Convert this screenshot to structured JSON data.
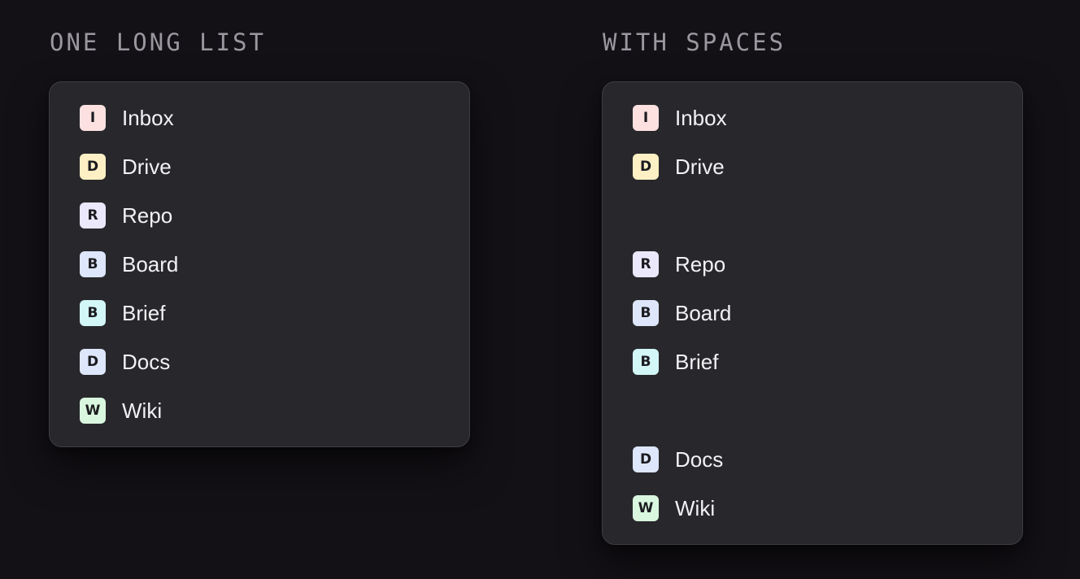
{
  "left": {
    "heading": "ONE LONG LIST",
    "items": [
      {
        "letter": "I",
        "label": "Inbox",
        "color": "#fde1e1"
      },
      {
        "letter": "D",
        "label": "Drive",
        "color": "#fdf0c4"
      },
      {
        "letter": "R",
        "label": "Repo",
        "color": "#ebe8fb"
      },
      {
        "letter": "B",
        "label": "Board",
        "color": "#dde6fb"
      },
      {
        "letter": "B",
        "label": "Brief",
        "color": "#d3f6f7"
      },
      {
        "letter": "D",
        "label": "Docs",
        "color": "#dde6fb"
      },
      {
        "letter": "W",
        "label": "Wiki",
        "color": "#d9f7df"
      }
    ]
  },
  "right": {
    "heading": "WITH SPACES",
    "items": [
      {
        "letter": "I",
        "label": "Inbox",
        "color": "#fde1e1"
      },
      {
        "letter": "D",
        "label": "Drive",
        "color": "#fdf0c4"
      },
      {
        "letter": "R",
        "label": "Repo",
        "color": "#ebe8fb"
      },
      {
        "letter": "B",
        "label": "Board",
        "color": "#dde6fb"
      },
      {
        "letter": "B",
        "label": "Brief",
        "color": "#d3f6f7"
      },
      {
        "letter": "D",
        "label": "Docs",
        "color": "#dde6fb"
      },
      {
        "letter": "W",
        "label": "Wiki",
        "color": "#d9f7df"
      }
    ]
  }
}
